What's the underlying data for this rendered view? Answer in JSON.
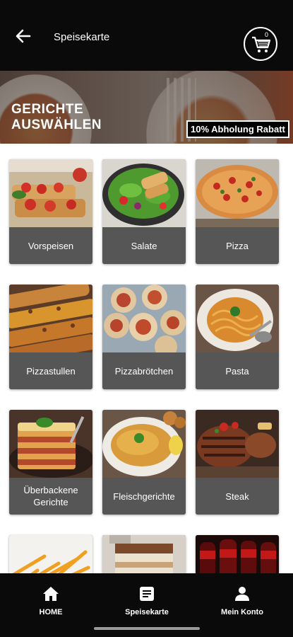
{
  "header": {
    "title": "Speisekarte",
    "cart_count": "0"
  },
  "hero": {
    "title_line1": "GERICHTE",
    "title_line2": "AUSWÄHLEN",
    "badge": "10% Abholung Rabatt"
  },
  "categories": [
    {
      "label": "Vorspeisen"
    },
    {
      "label": "Salate"
    },
    {
      "label": "Pizza"
    },
    {
      "label": "Pizzastullen"
    },
    {
      "label": "Pizzabrötchen"
    },
    {
      "label": "Pasta"
    },
    {
      "label": "Überbackene Gerichte"
    },
    {
      "label": "Fleischgerichte"
    },
    {
      "label": "Steak"
    },
    {
      "label": ""
    },
    {
      "label": ""
    },
    {
      "label": ""
    }
  ],
  "nav": {
    "home": "HOME",
    "menu": "Speisekarte",
    "account": "Mein Konto"
  },
  "icons": {
    "back": "arrow-left-icon",
    "cart": "cart-icon",
    "home": "home-icon",
    "menu": "menu-doc-icon",
    "account": "person-icon"
  }
}
